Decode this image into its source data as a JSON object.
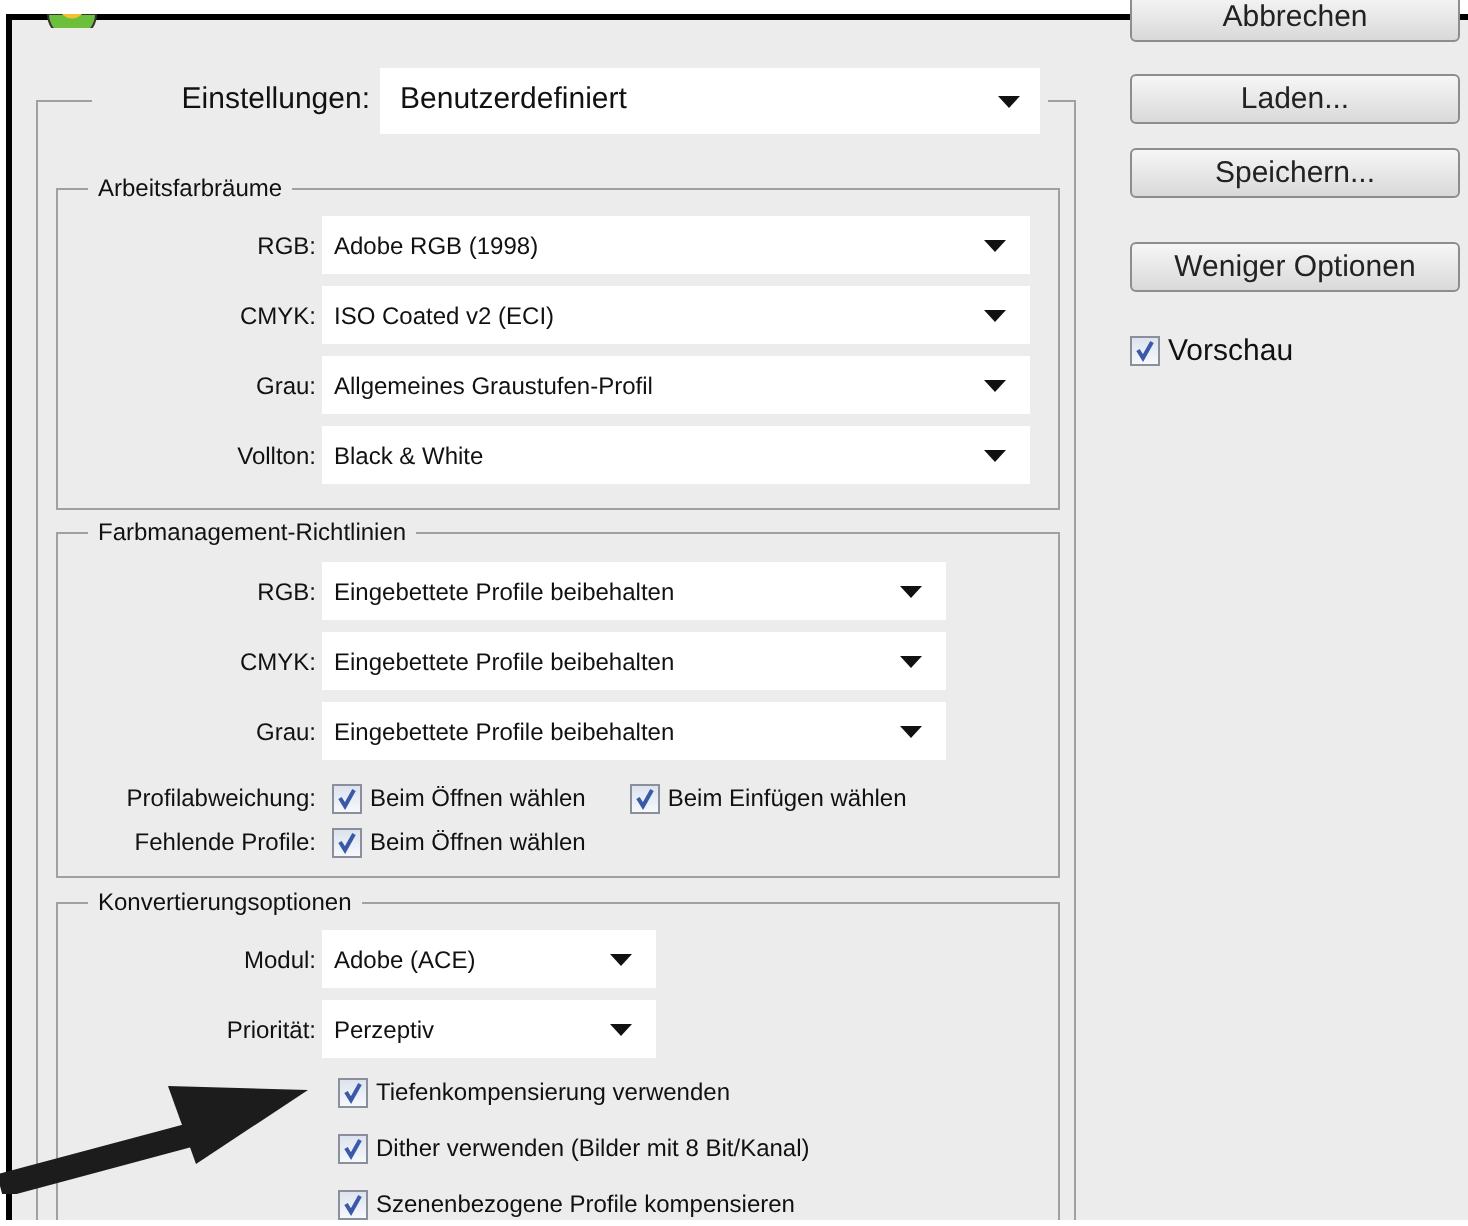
{
  "buttons": [
    {
      "label": "Abbrechen"
    },
    {
      "label": "Laden..."
    },
    {
      "label": "Speichern..."
    },
    {
      "label": "Weniger Optionen"
    }
  ],
  "preview": {
    "label": "Vorschau",
    "checked": true
  },
  "settings": {
    "label": "Einstellungen:",
    "value": "Benutzerdefiniert"
  },
  "groups": [
    {
      "title": "Arbeitsfarbräume",
      "rows": [
        {
          "kind": "dropdown",
          "label": "RGB:",
          "value": "Adobe RGB (1998)"
        },
        {
          "kind": "dropdown",
          "label": "CMYK:",
          "value": "ISO Coated v2 (ECI)"
        },
        {
          "kind": "dropdown",
          "label": "Grau:",
          "value": "Allgemeines Graustufen-Profil"
        },
        {
          "kind": "dropdown",
          "label": "Vollton:",
          "value": "Black & White"
        }
      ]
    },
    {
      "title": "Farbmanagement-Richtlinien",
      "rows": [
        {
          "kind": "dropdown",
          "label": "RGB:",
          "value": "Eingebettete Profile beibehalten"
        },
        {
          "kind": "dropdown",
          "label": "CMYK:",
          "value": "Eingebettete Profile beibehalten"
        },
        {
          "kind": "dropdown",
          "label": "Grau:",
          "value": "Eingebettete Profile beibehalten"
        },
        {
          "kind": "checks",
          "label": "Profilabweichung:",
          "options": [
            {
              "label": "Beim Öffnen wählen",
              "checked": true
            },
            {
              "label": "Beim Einfügen wählen",
              "checked": true
            }
          ]
        },
        {
          "kind": "checks",
          "label": "Fehlende Profile:",
          "options": [
            {
              "label": "Beim Öffnen wählen",
              "checked": true
            }
          ]
        }
      ]
    },
    {
      "title": "Konvertierungsoptionen",
      "rows": [
        {
          "kind": "dropdown",
          "label": "Modul:",
          "value": "Adobe (ACE)"
        },
        {
          "kind": "dropdown",
          "label": "Priorität:",
          "value": "Perzeptiv"
        },
        {
          "kind": "check",
          "label": "Tiefenkompensierung verwenden",
          "checked": true
        },
        {
          "kind": "check",
          "label": "Dither verwenden (Bilder mit 8 Bit/Kanal)",
          "checked": true
        },
        {
          "kind": "check",
          "label": "Szenenbezogene Profile kompensieren",
          "checked": true
        }
      ]
    }
  ]
}
